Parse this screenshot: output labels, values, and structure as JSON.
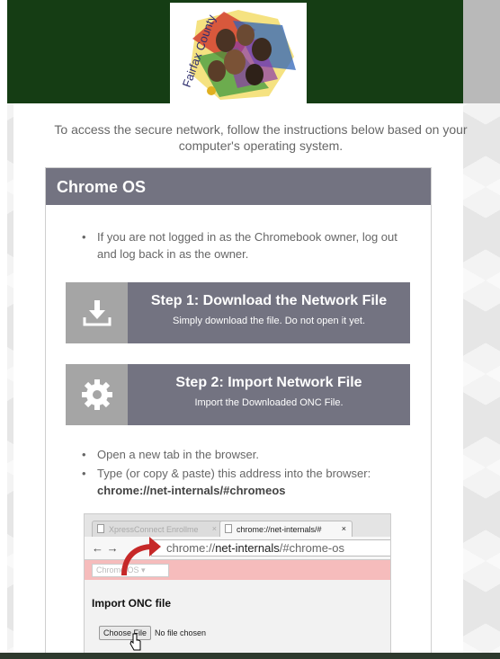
{
  "header": {
    "logo_text": "Fairfax County",
    "colors": {
      "header_bg": "#153d14",
      "panel_bg": "#737381",
      "icon_bg": "#a5a5a5"
    }
  },
  "intro_text": "To access the secure network, follow the instructions below based on your computer's operating system.",
  "section": {
    "title": "Chrome OS",
    "bullet1": "If you are not logged in as the Chromebook owner, log out and log back in as the owner.",
    "step1": {
      "title": "Step 1: Download the Network File",
      "subtitle": "Simply download the file. Do not open it yet.",
      "icon": "download-icon"
    },
    "step2": {
      "title": "Step 2: Import Network File",
      "subtitle": "Import the Downloaded ONC File.",
      "icon": "gear-icon"
    },
    "bullet2": "Open a new tab in the browser.",
    "bullet3": "Type (or copy & paste) this address into the browser:",
    "address_code": "chrome://net-internals/#chromeos"
  },
  "screenshot": {
    "tab_inactive": "XpressConnect Enrollme",
    "tab_active": "chrome://net-internals/#",
    "tab_close": "×",
    "url_scheme": "chrome://",
    "url_host": "net-internals",
    "url_path": "/#chrome-os",
    "os_select_value": "Chrome OS",
    "import_title": "Import ONC file",
    "choose_file_label": "Choose File",
    "no_file_text": "No file chosen"
  }
}
